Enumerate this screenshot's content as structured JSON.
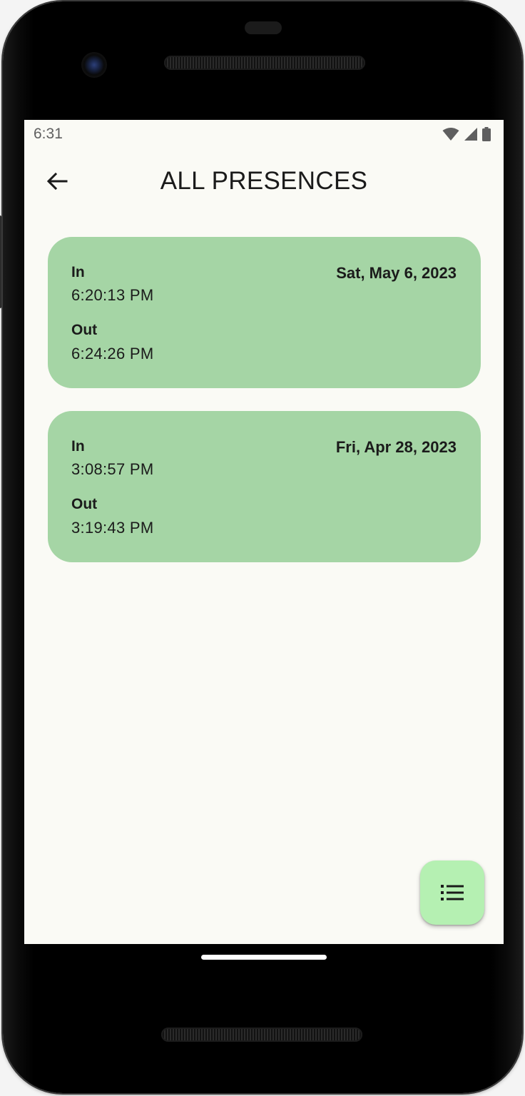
{
  "status_bar": {
    "time": "6:31",
    "icons": [
      "wifi-icon",
      "cellular-signal-icon",
      "battery-icon"
    ]
  },
  "app_bar": {
    "back_icon": "arrow-back-icon",
    "title": "ALL PRESENCES"
  },
  "presences": [
    {
      "in_label": "In",
      "in_time": "6:20:13 PM",
      "out_label": "Out",
      "out_time": "6:24:26 PM",
      "date": "Sat, May 6, 2023"
    },
    {
      "in_label": "In",
      "in_time": "3:08:57 PM",
      "out_label": "Out",
      "out_time": "3:19:43 PM",
      "date": "Fri, Apr 28, 2023"
    }
  ],
  "fab": {
    "icon": "list-icon"
  },
  "colors": {
    "screen_background": "#fafaf5",
    "card_background": "#a5d5a5",
    "fab_background": "#b5f0b2",
    "text": "#1b1b1b"
  }
}
